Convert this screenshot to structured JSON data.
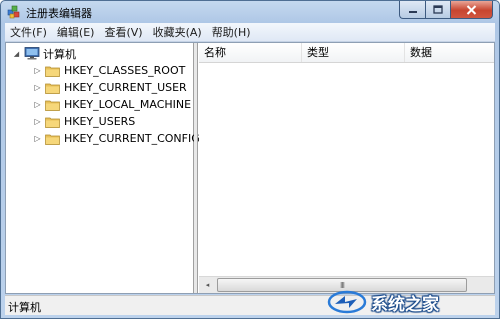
{
  "window": {
    "title": "注册表编辑器"
  },
  "menu": [
    "文件(F)",
    "编辑(E)",
    "查看(V)",
    "收藏夹(A)",
    "帮助(H)"
  ],
  "tree": {
    "root": {
      "label": "计算机",
      "expander": "◢"
    },
    "items": [
      {
        "label": "HKEY_CLASSES_ROOT",
        "expander": "▷"
      },
      {
        "label": "HKEY_CURRENT_USER",
        "expander": "▷"
      },
      {
        "label": "HKEY_LOCAL_MACHINE",
        "expander": "▷"
      },
      {
        "label": "HKEY_USERS",
        "expander": "▷"
      },
      {
        "label": "HKEY_CURRENT_CONFIG",
        "expander": "▷"
      }
    ]
  },
  "list": {
    "columns": [
      "名称",
      "类型",
      "数据"
    ],
    "scroll_left": "◂",
    "scroll_grip": "III"
  },
  "status": {
    "text": "计算机"
  },
  "watermark": {
    "text": "系统之家"
  },
  "colors": {
    "folder": "#e8c15a",
    "close_button": "#c8452f",
    "accent": "#4f6f93"
  }
}
